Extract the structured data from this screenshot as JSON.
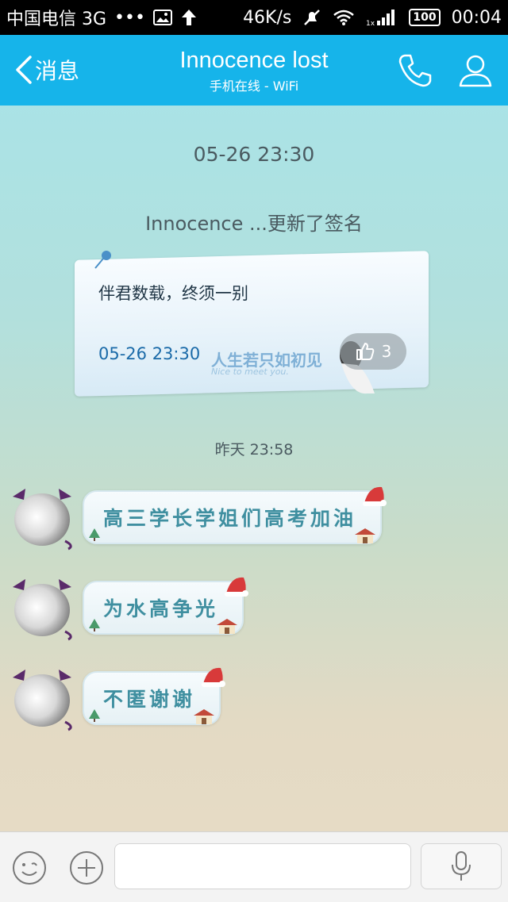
{
  "status_bar": {
    "carrier": "中国电信 3G",
    "dots": "•••",
    "speed": "46K/s",
    "battery": "100",
    "time": "00:04"
  },
  "header": {
    "back_label": "消息",
    "title": "Innocence lost",
    "subtitle": "手机在线 - WiFi"
  },
  "chat": {
    "timestamp_1": "05-26 23:30",
    "signature_notice": "Innocence ...更新了签名",
    "signature_card": {
      "text": "伴君数载，终须一别",
      "time": "05-26 23:30",
      "deco_text": "人生若只如初见",
      "deco_sub": "Nice to meet you.",
      "likes": "3"
    },
    "timestamp_2": "昨天 23:58",
    "messages": [
      {
        "text": "高三学长学姐们高考加油"
      },
      {
        "text": "为水高争光"
      },
      {
        "text": "不匿谢谢"
      }
    ]
  },
  "input_bar": {
    "placeholder": ""
  },
  "colors": {
    "header_bg": "#16b4ea",
    "bubble_text": "#3f8fa0"
  }
}
